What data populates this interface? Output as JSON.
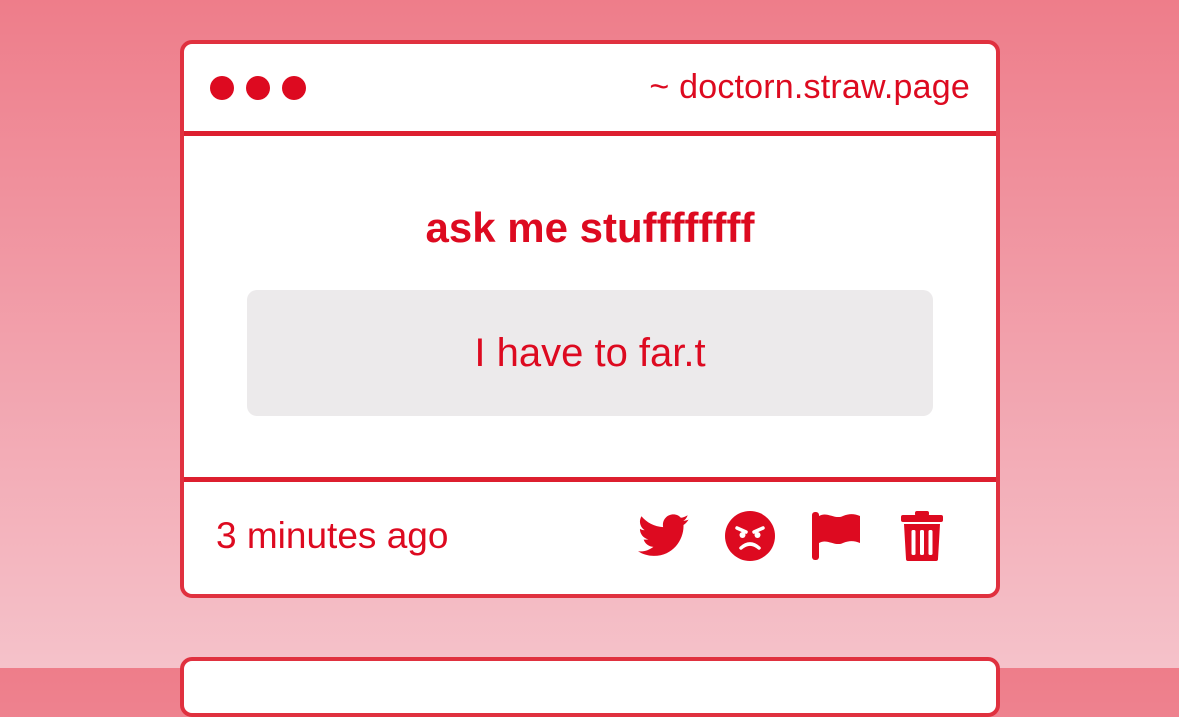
{
  "window": {
    "url": "~ doctorn.straw.page"
  },
  "content": {
    "prompt": "ask me stuffffffff",
    "question": "I have to far.t"
  },
  "footer": {
    "timestamp": "3 minutes ago",
    "actions": [
      "twitter-icon",
      "angry-face-icon",
      "flag-icon",
      "trash-icon"
    ]
  },
  "colors": {
    "accent": "#dd0a20",
    "border": "#e0313f",
    "question_bg": "#eceaeb",
    "background_top": "#ee7d8a",
    "background_bottom": "#f5c2ca"
  }
}
